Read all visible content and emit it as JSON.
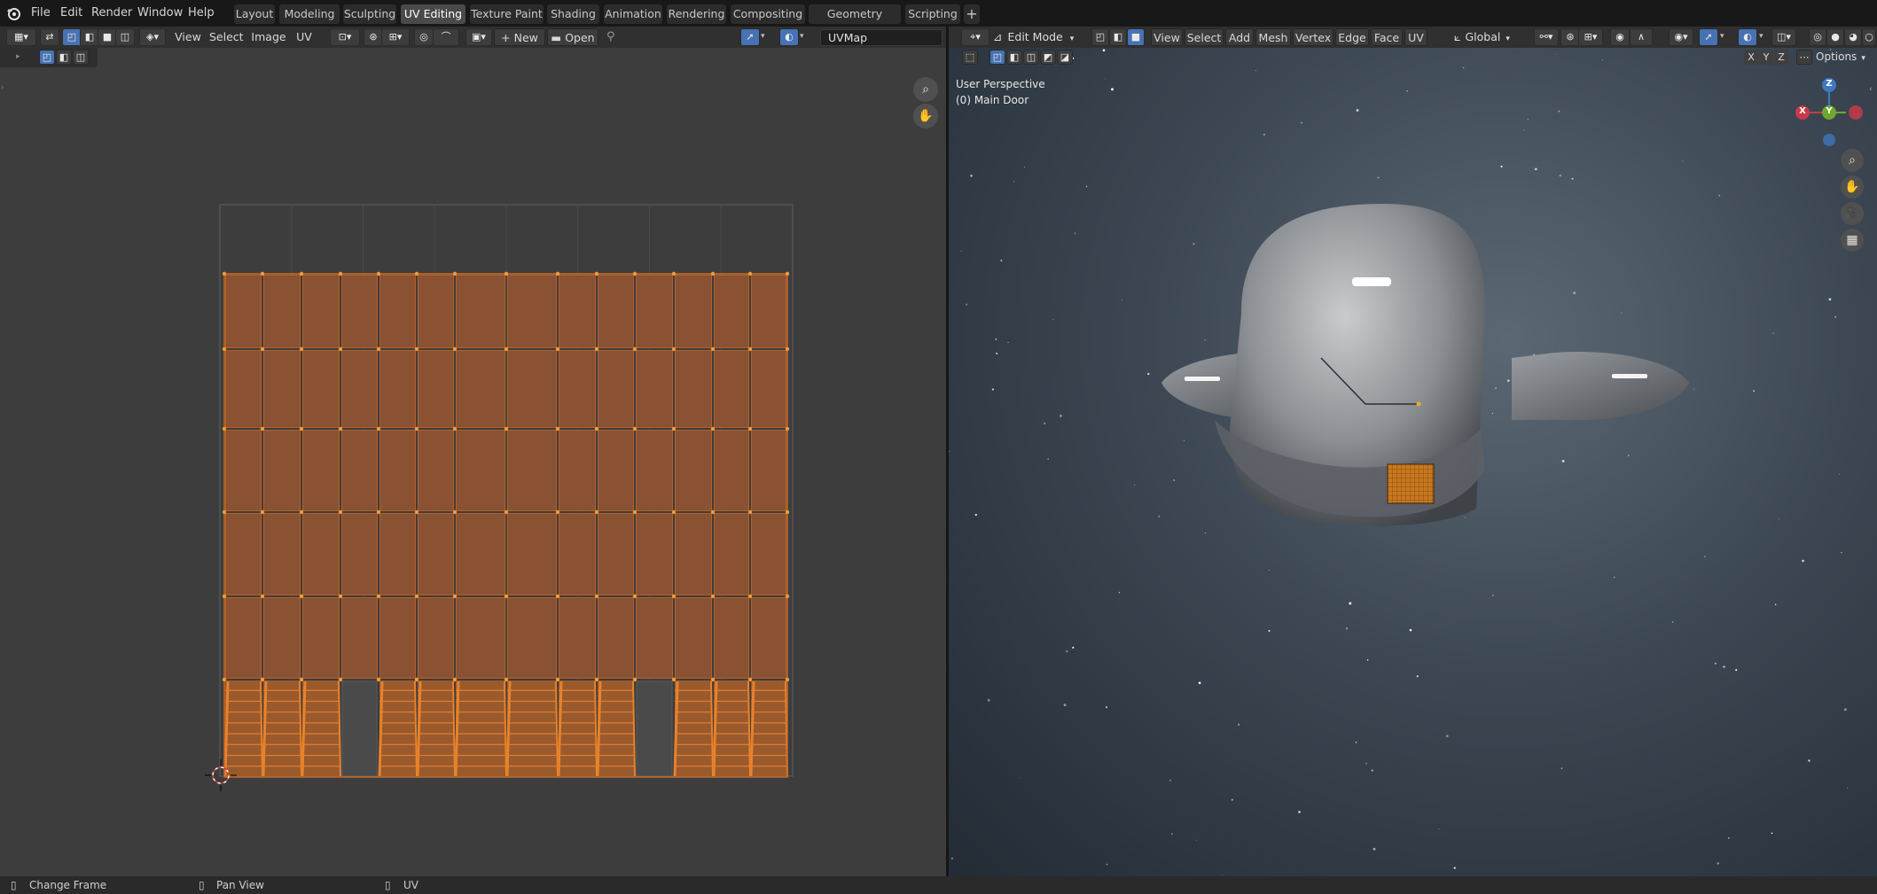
{
  "topbar": {
    "menus": [
      "File",
      "Edit",
      "Render",
      "Window",
      "Help"
    ],
    "workspaces": [
      "Layout",
      "Modeling",
      "Sculpting",
      "UV Editing",
      "Texture Paint",
      "Shading",
      "Animation",
      "Rendering",
      "Compositing",
      "Geometry Nodes",
      "Scripting"
    ],
    "active_workspace": "UV Editing",
    "add_tab": "+"
  },
  "uv_editor": {
    "menus": [
      "View",
      "Select",
      "Image",
      "UV"
    ],
    "new_label": "New",
    "open_label": "Open",
    "uvmap_name": "UVMap"
  },
  "viewport": {
    "mode": "Edit Mode",
    "menus": [
      "View",
      "Select",
      "Add",
      "Mesh",
      "Vertex",
      "Edge",
      "Face",
      "UV"
    ],
    "orientation": "Global",
    "axis_x": "X",
    "axis_y": "Y",
    "axis_z": "Z",
    "options_label": "Options",
    "overlay_title": "User Perspective",
    "overlay_object": "(0) Main Door",
    "gizmo": {
      "x": "X",
      "y": "Y",
      "z": "Z"
    }
  },
  "statusbar": {
    "items": [
      "Change Frame",
      "Pan View",
      "UV"
    ]
  },
  "colors": {
    "uv_face": "#8a5232",
    "uv_edge": "#e8822a",
    "active_tab": "#4a4a4a",
    "selection_blue": "#4772b3"
  }
}
